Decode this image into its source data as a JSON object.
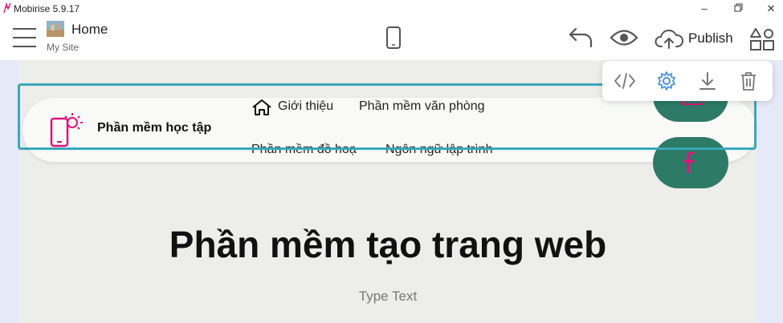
{
  "window": {
    "title": "Mobirise 5.9.17",
    "controls": [
      "minimize",
      "restore",
      "close"
    ]
  },
  "toolbar": {
    "page_name": "Home",
    "site_name": "My Site",
    "publish_label": "Publish",
    "icons": [
      "menu-icon",
      "page-thumbnail",
      "mobile-preview-icon",
      "undo-icon",
      "preview-icon",
      "cloud-upload-icon",
      "blocks-icon"
    ]
  },
  "block_tools": {
    "icons": [
      "code-icon",
      "gear-icon",
      "download-icon",
      "trash-icon"
    ],
    "accent": "#4a90d9"
  },
  "navbar": {
    "brand": "Phần mềm học tập",
    "links": [
      "Giới thiệu",
      "Phần mềm văn phòng",
      "Phần mềm đồ hoạ",
      "Ngôn ngữ lập trình"
    ],
    "social_color": "#2d7a67",
    "brand_color": "#e0137a"
  },
  "hero": {
    "title": "Phần mềm tạo trang web",
    "subtitle": "Type Text"
  },
  "colors": {
    "selection": "#3aa8bb",
    "canvas": "#ededea"
  }
}
